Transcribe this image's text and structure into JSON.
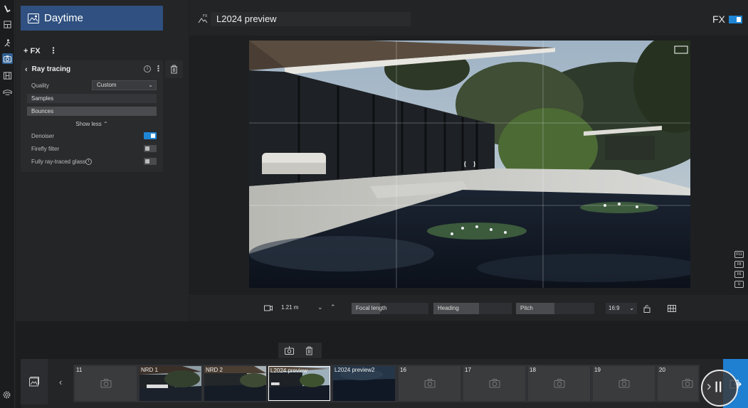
{
  "app": {
    "preset_name": "Daytime",
    "view_name": "L2024 preview",
    "fx_label": "FX",
    "accent_color": "#1f86d6",
    "header_color": "#2f5080"
  },
  "toolbar": {
    "icons": [
      "logo-icon",
      "layers-icon",
      "figure-icon",
      "camera-icon",
      "film-icon",
      "vr-icon"
    ],
    "active": "camera-icon"
  },
  "fx_panel": {
    "add_label": "+ FX",
    "effect": {
      "title": "Ray tracing",
      "quality_label": "Quality",
      "quality_value": "Custom",
      "samples_label": "Samples",
      "bounces_label": "Bounces",
      "show_less": "Show less",
      "options": [
        {
          "label": "Denoiser",
          "on": true
        },
        {
          "label": "Firefly filter",
          "on": false
        },
        {
          "label": "Fully ray-traced glass",
          "on": false
        }
      ]
    }
  },
  "hotkeys": [
    "F11",
    "F8",
    "F6",
    "U"
  ],
  "camera": {
    "distance": "1.21 m",
    "focal_length": "Focal length",
    "heading": "Heading",
    "pitch": "Pitch",
    "aspect": "16:9"
  },
  "filmstrip": {
    "thumbnails": [
      {
        "label": "11",
        "type": "empty"
      },
      {
        "label": "NRD 1",
        "type": "image"
      },
      {
        "label": "NRD 2",
        "type": "image"
      },
      {
        "label": "L2024 preview",
        "type": "image",
        "selected": true
      },
      {
        "label": "L2024 preview2",
        "type": "image"
      },
      {
        "label": "16",
        "type": "empty"
      },
      {
        "label": "17",
        "type": "empty"
      },
      {
        "label": "18",
        "type": "empty"
      },
      {
        "label": "19",
        "type": "empty"
      },
      {
        "label": "20",
        "type": "empty"
      }
    ]
  }
}
